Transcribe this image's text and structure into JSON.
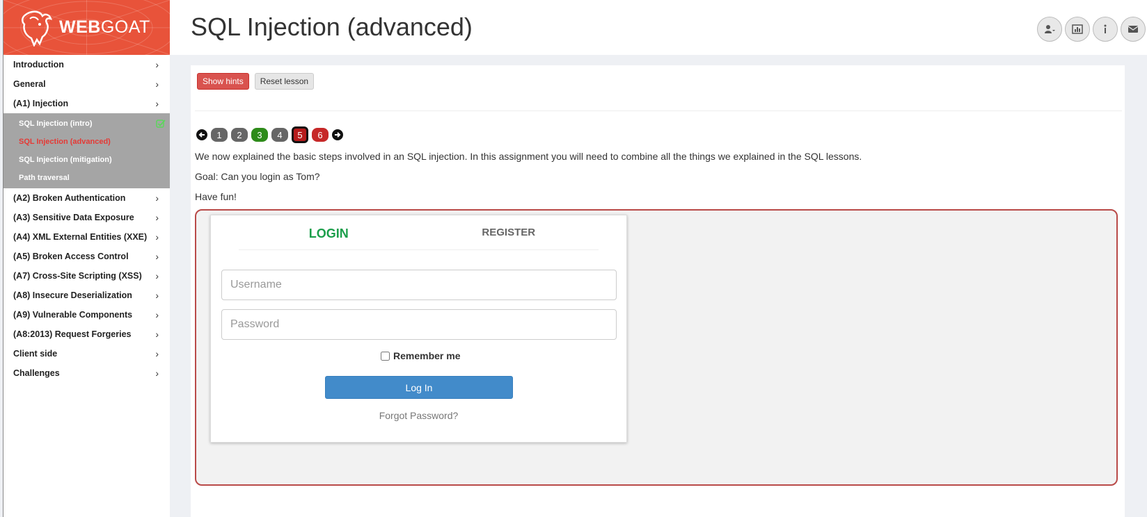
{
  "brand": {
    "bold": "WEB",
    "light": "GOAT"
  },
  "sidebar": {
    "items_top": [
      {
        "label": "Introduction"
      },
      {
        "label": "General"
      },
      {
        "label": "(A1) Injection"
      }
    ],
    "submenu": [
      {
        "label": "SQL Injection (intro)",
        "completed": true
      },
      {
        "label": "SQL Injection (advanced)",
        "active": true
      },
      {
        "label": "SQL Injection (mitigation)"
      },
      {
        "label": "Path traversal"
      }
    ],
    "items_bottom": [
      {
        "label": "(A2) Broken Authentication"
      },
      {
        "label": "(A3) Sensitive Data Exposure"
      },
      {
        "label": "(A4) XML External Entities (XXE)"
      },
      {
        "label": "(A5) Broken Access Control"
      },
      {
        "label": "(A7) Cross-Site Scripting (XSS)"
      },
      {
        "label": "(A8) Insecure Deserialization"
      },
      {
        "label": "(A9) Vulnerable Components"
      },
      {
        "label": "(A8:2013) Request Forgeries"
      },
      {
        "label": "Client side"
      },
      {
        "label": "Challenges"
      }
    ],
    "chevron": "›"
  },
  "header": {
    "title": "SQL Injection (advanced)",
    "icons": [
      "user-icon",
      "bar-chart-icon",
      "info-icon",
      "envelope-icon"
    ]
  },
  "lesson": {
    "show_hints": "Show hints",
    "reset_lesson": "Reset lesson",
    "pages": [
      {
        "label": "1",
        "state": "gray"
      },
      {
        "label": "2",
        "state": "gray"
      },
      {
        "label": "3",
        "state": "green"
      },
      {
        "label": "4",
        "state": "gray"
      },
      {
        "label": "5",
        "state": "current"
      },
      {
        "label": "6",
        "state": "red"
      }
    ],
    "intro": "We now explained the basic steps involved in an SQL injection. In this assignment you will need to combine all the things we explained in the SQL lessons.",
    "goal": "Goal: Can you login as Tom?",
    "fun": "Have fun!"
  },
  "login_form": {
    "tab_login": "LOGIN",
    "tab_register": "REGISTER",
    "username_placeholder": "Username",
    "password_placeholder": "Password",
    "remember_me": "Remember me",
    "login_button": "Log In",
    "forgot_password": "Forgot Password?"
  },
  "colors": {
    "brand": "#e8533a",
    "submenu_bg": "#a5a5a5",
    "active_red": "#e53935",
    "login_green": "#1a9e4a",
    "primary_blue": "#428bca"
  }
}
